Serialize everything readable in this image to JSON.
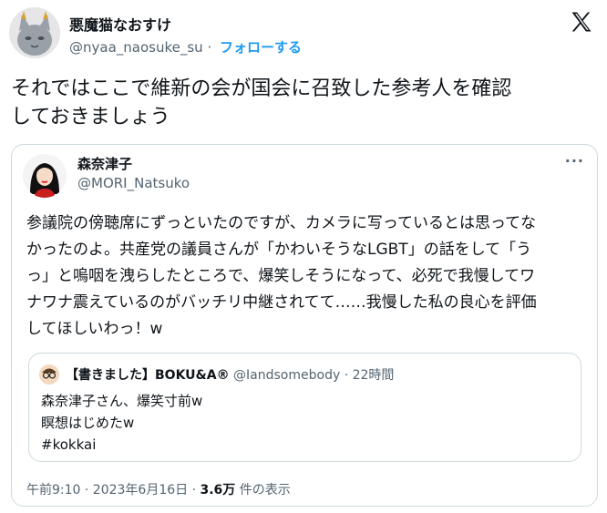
{
  "author": {
    "name": "悪魔猫なおすけ",
    "handle": "@nyaa_naosuke_su",
    "separator": "·",
    "follow_label": "フォローする"
  },
  "tweet": {
    "text_line1": "それではここで維新の会が国会に召致した参考人を確認",
    "text_line2": "しておきましょう"
  },
  "quoted": {
    "name": "森奈津子",
    "handle": "@MORI_Natsuko",
    "more_label": "···",
    "lines": [
      "参議院の傍聴席にずっといたのですが、カメラに写っているとは思ってな",
      "かったのよ。共産党の議員さんが「かわいそうなLGBT」の話をして「う",
      "っ」と嗚咽を洩らしたところで、爆笑しそうになって、必死で我慢してワ",
      "ナワナ震えているのがバッチリ中継されてて……我慢した私の良心を評価",
      "してほしいわっ！w"
    ],
    "inner": {
      "name": "【書きました】BOKU&A®",
      "handle": "@Iandsomebody",
      "time": "· 22時間",
      "lines": [
        "森奈津子さん、爆笑寸前w",
        "瞑想はじめたw",
        "#kokkai"
      ]
    },
    "meta": {
      "datetime": "午前9:10 · 2023年6月16日 ·",
      "views_count": "3.6万",
      "views_label": "件の表示"
    }
  },
  "colors": {
    "accent": "#1d9bf0",
    "text": "#0f1419",
    "muted": "#536471",
    "border": "#cfd9de"
  },
  "icons": {
    "brand": "x-logo-icon",
    "more": "more-icon"
  }
}
